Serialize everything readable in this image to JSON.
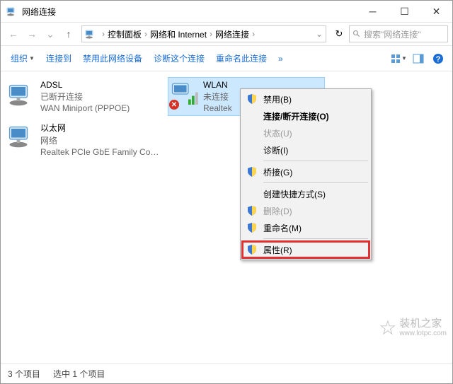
{
  "window": {
    "title": "网络连接"
  },
  "breadcrumb": {
    "items": [
      "控制面板",
      "网络和 Internet",
      "网络连接"
    ]
  },
  "search": {
    "placeholder": "搜索\"网络连接\""
  },
  "toolbar": {
    "org": "组织",
    "connect": "连接到",
    "disable": "禁用此网络设备",
    "diagnose": "诊断这个连接",
    "rename": "重命名此连接",
    "more": "»"
  },
  "connections": [
    {
      "name": "ADSL",
      "status": "已断开连接",
      "detail": "WAN Miniport (PPPOE)"
    },
    {
      "name": "WLAN",
      "status": "未连接",
      "detail": "Realtek"
    },
    {
      "name": "以太网",
      "status": "网络",
      "detail": "Realtek PCIe GbE Family Contr..."
    }
  ],
  "contextMenu": {
    "disable": "禁用(B)",
    "toggle": "连接/断开连接(O)",
    "status": "状态(U)",
    "diagnose": "诊断(I)",
    "bridge": "桥接(G)",
    "shortcut": "创建快捷方式(S)",
    "delete": "删除(D)",
    "rename": "重命名(M)",
    "properties": "属性(R)"
  },
  "statusbar": {
    "count": "3 个项目",
    "selected": "选中 1 个项目"
  },
  "watermark": {
    "text": "装机之家",
    "url": "www.lotpc.com"
  }
}
